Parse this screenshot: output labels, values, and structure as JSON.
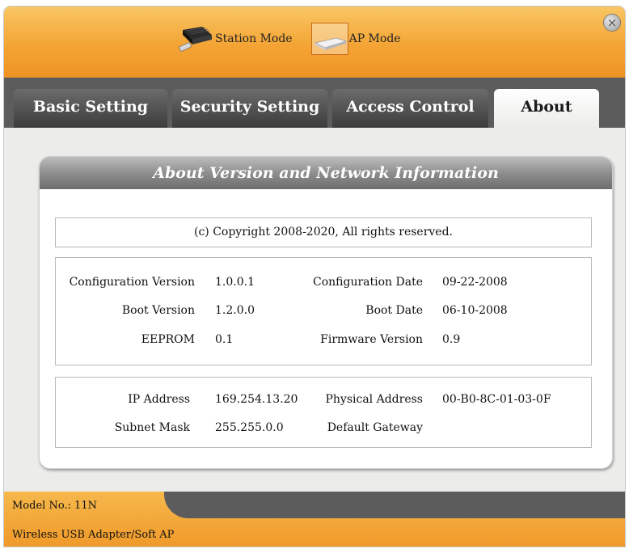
{
  "modes": [
    {
      "label": "Station Mode",
      "icon": "network-card-icon",
      "active": false
    },
    {
      "label": "AP Mode",
      "icon": "access-point-icon",
      "active": true
    }
  ],
  "tabs": [
    {
      "label": "Basic Setting"
    },
    {
      "label": "Security Setting"
    },
    {
      "label": "Access Control"
    },
    {
      "label": "About",
      "active": true
    }
  ],
  "panel": {
    "title": "About Version and Network Information",
    "copyright": "(c) Copyright 2008-2020,  All rights reserved."
  },
  "version_info": {
    "config_version_label": "Configuration Version",
    "config_version": "1.0.0.1",
    "config_date_label": "Configuration Date",
    "config_date": "09-22-2008",
    "boot_version_label": "Boot Version",
    "boot_version": "1.2.0.0",
    "boot_date_label": "Boot Date",
    "boot_date": "06-10-2008",
    "eeprom_label": "EEPROM",
    "eeprom": "0.1",
    "firmware_label": "Firmware Version",
    "firmware": "0.9"
  },
  "network_info": {
    "ip_label": "IP Address",
    "ip": "169.254.13.20",
    "mac_label": "Physical Address",
    "mac": "00-B0-8C-01-03-0F",
    "subnet_label": "Subnet Mask",
    "subnet": "255.255.0.0",
    "gateway_label": "Default Gateway",
    "gateway": ""
  },
  "footer": {
    "model": "Model No.: 11N",
    "description": "Wireless USB Adapter/Soft AP"
  },
  "colors": {
    "accent_orange": "#f4a434",
    "tab_dark": "#4a4a4a",
    "panel_header": "#8e8e8e"
  }
}
